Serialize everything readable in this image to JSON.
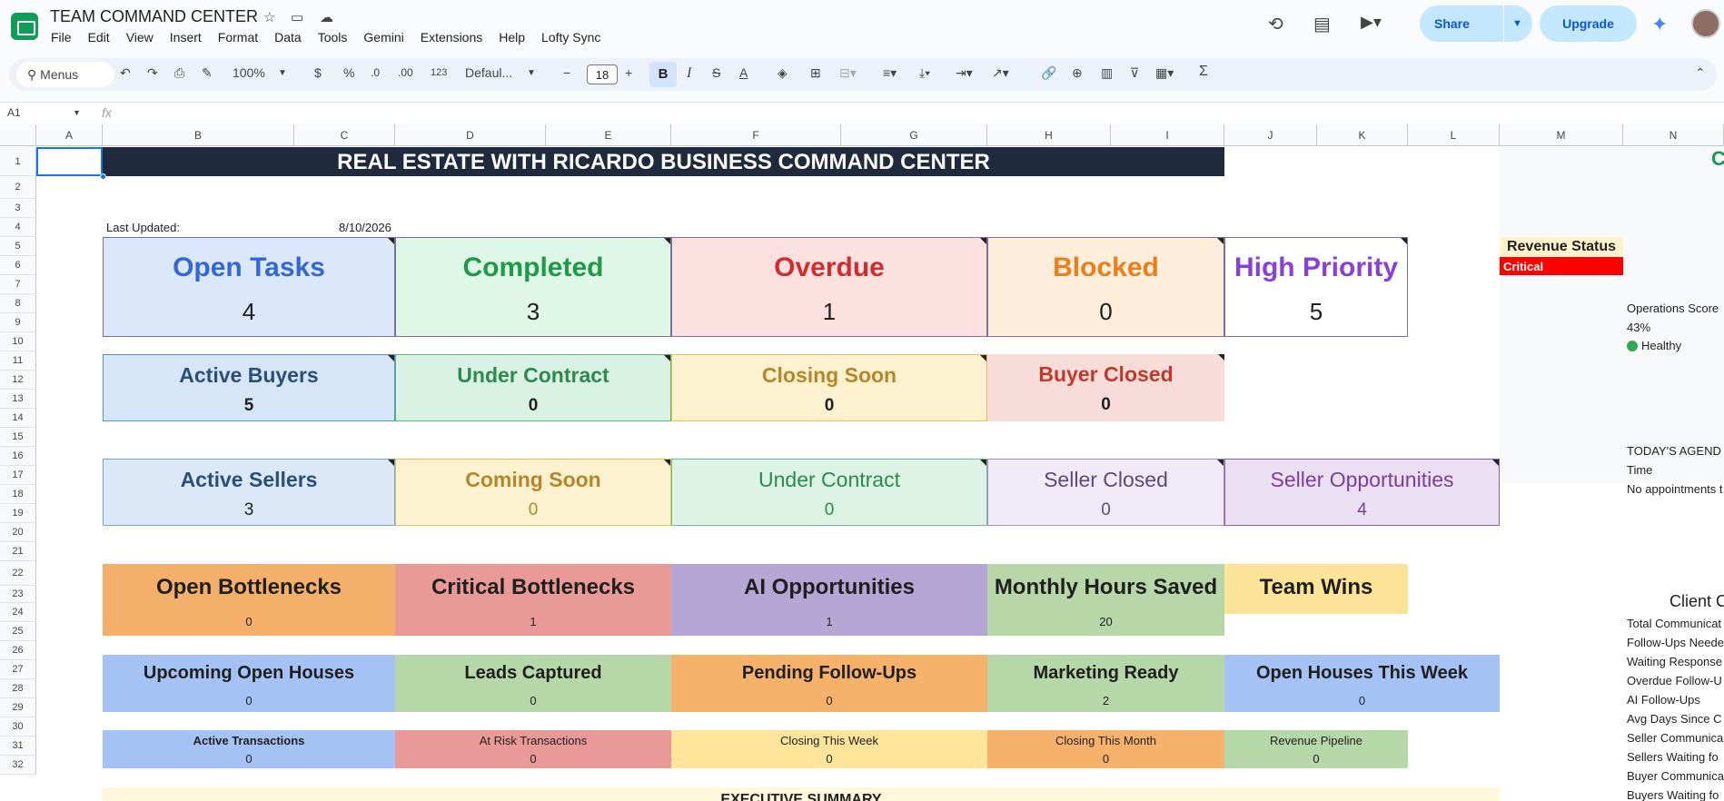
{
  "app": {
    "title": "TEAM COMMAND CENTER",
    "menus": [
      "File",
      "Edit",
      "View",
      "Insert",
      "Format",
      "Data",
      "Tools",
      "Gemini",
      "Extensions",
      "Help",
      "Lofty Sync"
    ],
    "share_label": "Share",
    "upgrade_label": "Upgrade"
  },
  "toolbar": {
    "search_label": "Menus",
    "zoom": "100%",
    "currency": "$",
    "percent": "%",
    "dec_down": ".0",
    "dec_up": ".00",
    "num_format": "123",
    "font": "Defaul...",
    "font_size": "18",
    "bold": "B",
    "italic": "I",
    "strike": "S",
    "text_color": "A",
    "sum": "Σ"
  },
  "formula_bar": {
    "name_box": "A1",
    "fx": "fx"
  },
  "columns": [
    "A",
    "B",
    "C",
    "D",
    "E",
    "F",
    "G",
    "H",
    "I",
    "J",
    "K",
    "L",
    "M",
    "N"
  ],
  "rows": [
    "1",
    "2",
    "3",
    "4",
    "5",
    "6",
    "7",
    "8",
    "9",
    "10",
    "11",
    "12",
    "13",
    "14",
    "15",
    "16",
    "17",
    "18",
    "19",
    "20",
    "21",
    "22",
    "23",
    "24",
    "25",
    "26",
    "27",
    "28",
    "29",
    "30",
    "31",
    "32"
  ],
  "sheet": {
    "title": "REAL ESTATE WITH RICARDO BUSINESS COMMAND CENTER",
    "last_updated_label": "Last Updated:",
    "last_updated_value": "8/10/2026",
    "tasks": [
      {
        "label": "Open Tasks",
        "value": "4"
      },
      {
        "label": "Completed",
        "value": "3"
      },
      {
        "label": "Overdue",
        "value": "1"
      },
      {
        "label": "Blocked",
        "value": "0"
      },
      {
        "label": "High Priority",
        "value": "5"
      }
    ],
    "buyers": [
      {
        "label": "Active Buyers",
        "value": "5"
      },
      {
        "label": "Under Contract",
        "value": "0"
      },
      {
        "label": "Closing Soon",
        "value": "0"
      },
      {
        "label": "Buyer Closed",
        "value": "0"
      }
    ],
    "sellers": [
      {
        "label": "Active Sellers",
        "value": "3"
      },
      {
        "label": "Coming Soon",
        "value": "0"
      },
      {
        "label": "Under Contract",
        "value": "0"
      },
      {
        "label": "Seller Closed",
        "value": "0"
      },
      {
        "label": "Seller Opportunities",
        "value": "4"
      }
    ],
    "ops": [
      {
        "label": "Open Bottlenecks",
        "value": "0"
      },
      {
        "label": "Critical Bottlenecks",
        "value": "1"
      },
      {
        "label": "AI Opportunities",
        "value": "1"
      },
      {
        "label": "Monthly Hours Saved",
        "value": "20"
      },
      {
        "label": "Team Wins",
        "value": ""
      }
    ],
    "marketing": [
      {
        "label": "Upcoming Open Houses",
        "value": "0"
      },
      {
        "label": "Leads Captured",
        "value": "0"
      },
      {
        "label": "Pending Follow-Ups",
        "value": "0"
      },
      {
        "label": "Marketing Ready",
        "value": "2"
      },
      {
        "label": "Open Houses This Week",
        "value": "0"
      }
    ],
    "transactions": [
      {
        "label": "Active Transactions",
        "value": "0"
      },
      {
        "label": "At Risk Transactions",
        "value": "0"
      },
      {
        "label": "Closing This Week",
        "value": "0"
      },
      {
        "label": "Closing This Month",
        "value": "0"
      },
      {
        "label": "Revenue Pipeline",
        "value": "0"
      }
    ],
    "executive_summary": "EXECUTIVE SUMMARY",
    "revenue_status_label": "Revenue Status",
    "revenue_status_value": "Critical",
    "operations_score_label": "Operations Score",
    "operations_score_value": "43%",
    "operations_health": "Healthy",
    "n1_partial": "C",
    "agenda": {
      "title": "TODAY'S AGEND",
      "time_header": "Time",
      "empty": "No appointments t"
    },
    "client_header": "Client C",
    "client_list": [
      "Total Communicat",
      "Follow-Ups Neede",
      "Waiting Response",
      "Overdue Follow-U",
      "AI Follow-Ups",
      "Avg Days Since C",
      "Seller Communica",
      "Sellers Waiting fo",
      "Buyer Communica",
      "Buyers Waiting fo"
    ]
  },
  "colors": {
    "header_dark": "#1f2a3c",
    "brand_blue": "#0b57d0",
    "critical_red": "#ff0000",
    "healthy_green": "#34a853"
  }
}
